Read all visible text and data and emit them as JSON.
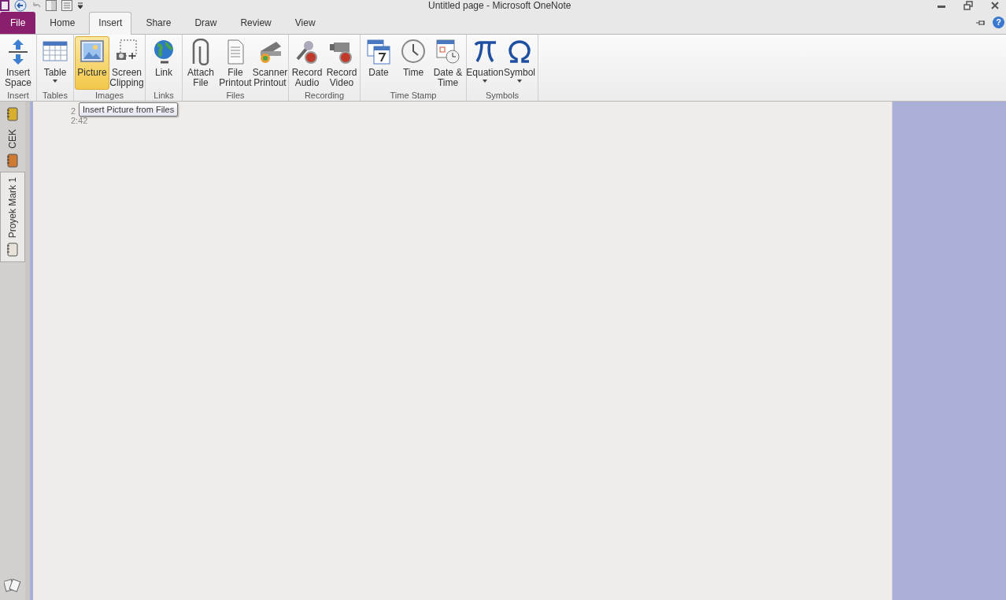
{
  "window": {
    "title": "Untitled page - Microsoft OneNote"
  },
  "tabs": [
    {
      "label": "File",
      "kind": "file",
      "selected": false
    },
    {
      "label": "Home",
      "kind": "tab",
      "selected": false
    },
    {
      "label": "Insert",
      "kind": "tab",
      "selected": true
    },
    {
      "label": "Share",
      "kind": "tab",
      "selected": false
    },
    {
      "label": "Draw",
      "kind": "tab",
      "selected": false
    },
    {
      "label": "Review",
      "kind": "tab",
      "selected": false
    },
    {
      "label": "View",
      "kind": "tab",
      "selected": false
    }
  ],
  "ribbon": {
    "groups": [
      {
        "label": "Insert",
        "buttons": [
          {
            "label": "Insert Space",
            "kind": "space",
            "dropdown": false,
            "selected": false
          }
        ]
      },
      {
        "label": "Tables",
        "buttons": [
          {
            "label": "Table",
            "kind": "table",
            "dropdown": true,
            "selected": false
          }
        ]
      },
      {
        "label": "Images",
        "buttons": [
          {
            "label": "Picture",
            "kind": "picture",
            "dropdown": false,
            "selected": true
          },
          {
            "label": "Screen Clipping",
            "kind": "clip",
            "dropdown": false,
            "selected": false
          }
        ]
      },
      {
        "label": "Links",
        "buttons": [
          {
            "label": "Link",
            "kind": "globe",
            "dropdown": false,
            "selected": false
          }
        ]
      },
      {
        "label": "Files",
        "buttons": [
          {
            "label": "Attach File",
            "kind": "paperclip",
            "dropdown": false,
            "selected": false
          },
          {
            "label": "File Printout",
            "kind": "doc",
            "dropdown": false,
            "selected": false
          },
          {
            "label": "Scanner Printout",
            "kind": "scanner",
            "dropdown": false,
            "selected": false
          }
        ]
      },
      {
        "label": "Recording",
        "buttons": [
          {
            "label": "Record Audio",
            "kind": "mic",
            "dropdown": false,
            "selected": false
          },
          {
            "label": "Record Video",
            "kind": "camera",
            "dropdown": false,
            "selected": false
          }
        ]
      },
      {
        "label": "Time Stamp",
        "buttons": [
          {
            "label": "Date",
            "kind": "calendar",
            "dropdown": false,
            "selected": false
          },
          {
            "label": "Time",
            "kind": "clock",
            "dropdown": false,
            "selected": false
          },
          {
            "label": "Date & Time",
            "kind": "datetime",
            "dropdown": false,
            "selected": false
          }
        ]
      },
      {
        "label": "Symbols",
        "buttons": [
          {
            "label": "Equation",
            "kind": "pi",
            "dropdown": true,
            "selected": false
          },
          {
            "label": "Symbol",
            "kind": "omega",
            "dropdown": true,
            "selected": false
          }
        ]
      }
    ]
  },
  "sidebar": {
    "notebooks": [
      {
        "color": "#d8ae2e",
        "selected": false
      },
      {
        "label": "CEK",
        "color": "#cf7a32",
        "selected": false
      },
      {
        "label": "Proyek Mark 1",
        "color": "#e8e2d8",
        "selected": true
      }
    ]
  },
  "page": {
    "lines": [
      "2",
      "2:42"
    ]
  },
  "help": {
    "label": "?"
  },
  "tooltip": {
    "text": "Insert Picture from Files"
  }
}
